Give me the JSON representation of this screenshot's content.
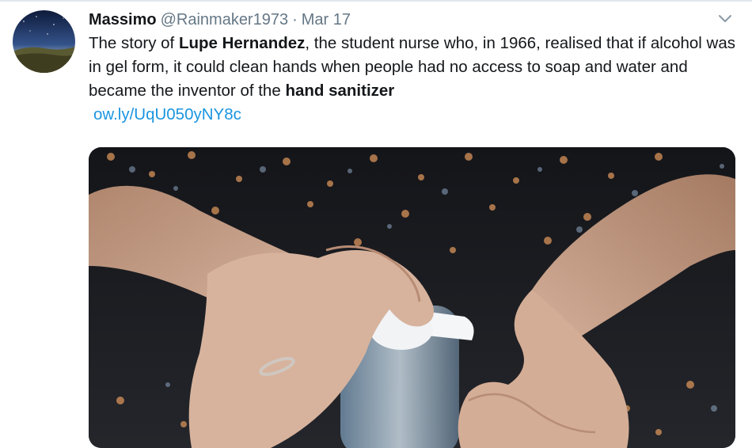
{
  "tweet": {
    "author_name": "Massimo",
    "author_handle": "@Rainmaker1973",
    "separator": "·",
    "timestamp": "Mar 17",
    "text_1": "The story of ",
    "bold_1": "Lupe Hernandez",
    "text_2": ", the student nurse who, in 1966, realised that if alcohol was in gel form, it could clean hands when people had no access to soap and water and became the inventor of the ",
    "bold_2": "hand sanitizer",
    "link": "ow.ly/UqU050yNY8c"
  },
  "icons": {
    "caret": "chevron-down-icon",
    "avatar": "night-sky-avatar"
  },
  "colors": {
    "link": "#1b95e0",
    "secondary_text": "#657786",
    "primary_text": "#14171a"
  }
}
